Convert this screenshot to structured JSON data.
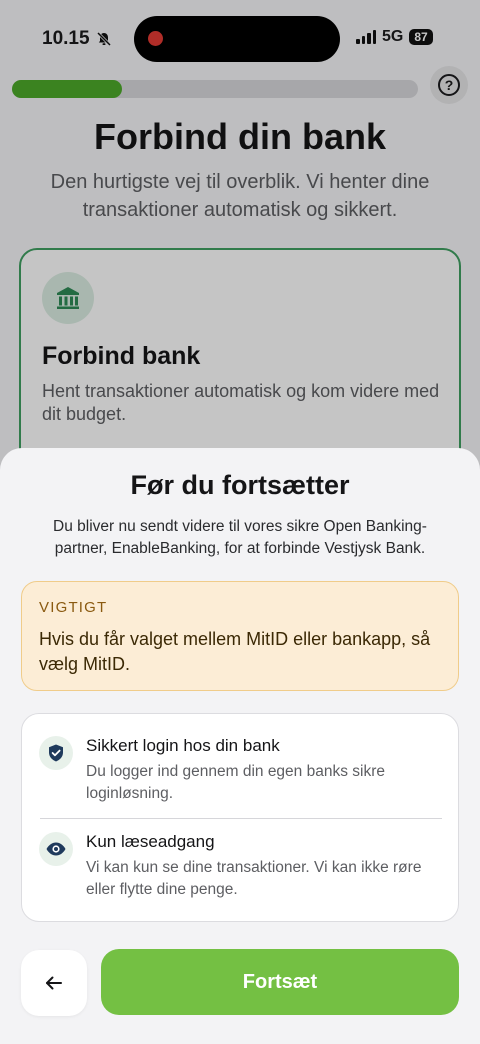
{
  "status_bar": {
    "time": "10.15",
    "network": "5G",
    "battery": "87"
  },
  "header": {
    "progress_fraction": 0.27
  },
  "page": {
    "title": "Forbind din bank",
    "subtitle": "Den hurtigste vej til overblik. Vi henter dine transaktioner automatisk og sikkert.",
    "card": {
      "title": "Forbind bank",
      "description": "Hent transaktioner automatisk og kom videre med dit budget."
    }
  },
  "sheet": {
    "title": "Før du fortsætter",
    "description": "Du bliver nu sendt videre til vores sikre Open Banking-partner, EnableBanking, for at forbinde Vestjysk Bank.",
    "important": {
      "label": "VIGTIGT",
      "text": "Hvis du får valget mellem MitID eller bankapp, så vælg MitID."
    },
    "items": [
      {
        "icon": "shield-check-icon",
        "title": "Sikkert login hos din bank",
        "description": "Du logger ind gennem din egen banks sikre loginløsning."
      },
      {
        "icon": "eye-icon",
        "title": "Kun læseadgang",
        "description": "Vi kan kun se dine transaktioner. Vi kan ikke røre eller flytte dine penge."
      }
    ],
    "continue_label": "Fortsæt"
  },
  "colors": {
    "accent_green": "#74c043",
    "progress_green": "#4ca82a",
    "card_border": "#3f9e61",
    "warning_bg": "#fcedd6",
    "warning_border": "#f0cc8a",
    "icon_dark": "#1f3a5c"
  }
}
